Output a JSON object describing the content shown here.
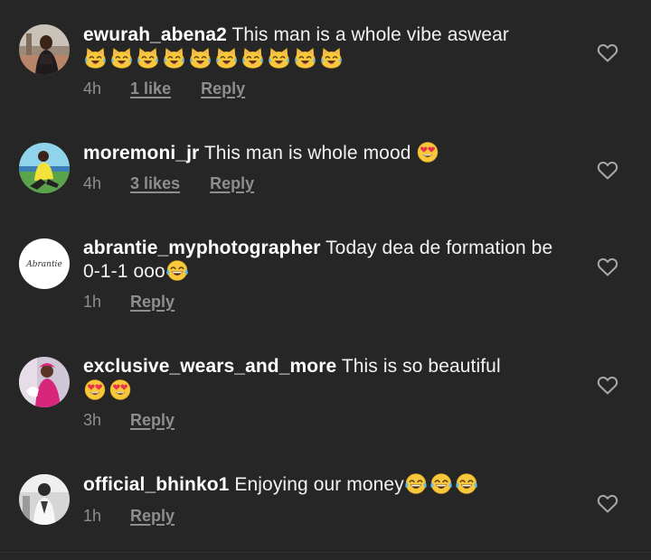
{
  "comments": [
    {
      "username": "ewurah_abena2",
      "text": "This man is a whole vibe aswear",
      "emoji": "cat-tears-of-joy-emoji",
      "emoji_count": 10,
      "time": "4h",
      "likes": "1 like",
      "reply": "Reply"
    },
    {
      "username": "moremoni_jr",
      "text": "This man is whole mood",
      "emoji": "heart-eyes-emoji",
      "emoji_count": 1,
      "time": "4h",
      "likes": "3 likes",
      "reply": "Reply"
    },
    {
      "username": "abrantie_myphotographer",
      "text": "Today dea de formation be 0-1-1 ooo",
      "emoji": "tears-of-joy-emoji",
      "emoji_count": 1,
      "avatar_logo_text": "Abrantie",
      "time": "1h",
      "reply": "Reply"
    },
    {
      "username": "exclusive_wears_and_more",
      "text": "This is so beautiful",
      "emoji": "heart-eyes-emoji",
      "emoji_count": 2,
      "time": "3h",
      "reply": "Reply"
    },
    {
      "username": "official_bhinko1",
      "text": "Enjoying our money",
      "emoji": "tears-of-joy-emoji",
      "emoji_count": 3,
      "time": "1h",
      "reply": "Reply"
    }
  ],
  "icons": {
    "like": "heart-outline-icon"
  },
  "colors": {
    "background": "#262626",
    "primary_text": "#ffffff",
    "secondary_text": "#8e8e8e"
  }
}
